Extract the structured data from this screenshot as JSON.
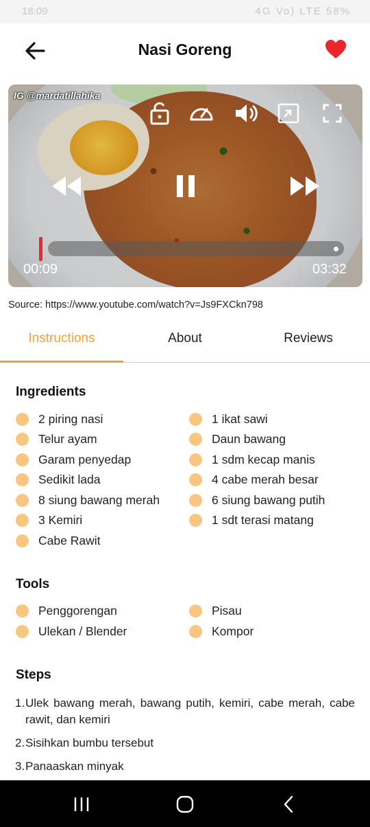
{
  "status_bar": {
    "time": "18:09",
    "right_text": "4G  Vo) LTE  58%"
  },
  "header": {
    "title": "Nasi Goreng"
  },
  "video": {
    "watermark": "IG @mardatillahika",
    "current_time": "00:09",
    "total_time": "03:32",
    "progress_fraction": 0.04
  },
  "source": "Source: https://www.youtube.com/watch?v=Js9FXCkn798",
  "tabs": [
    "Instructions",
    "About",
    "Reviews"
  ],
  "active_tab": "Instructions",
  "ingredients": {
    "title": "Ingredients",
    "left": [
      "2 piring nasi",
      "Telur ayam",
      "Garam penyedap",
      "Sedikit lada",
      "8 siung bawang merah",
      "3 Kemiri",
      "Cabe Rawit"
    ],
    "right": [
      "1 ikat sawi",
      "Daun bawang",
      "1 sdm kecap manis",
      "4 cabe merah besar",
      "6 siung bawang putih",
      "1 sdt terasi matang"
    ]
  },
  "tools": {
    "title": "Tools",
    "left": [
      "Penggorengan",
      "Ulekan / Blender"
    ],
    "right": [
      "Pisau",
      "Kompor"
    ]
  },
  "steps": {
    "title": "Steps",
    "items": [
      {
        "num": "1.",
        "text": "Ulek bawang merah, bawang putih, kemiri, cabe merah, cabe rawit, dan kemiri"
      },
      {
        "num": "2.",
        "text": "Sisihkan bumbu tersebut"
      },
      {
        "num": "3.",
        "text": "Panaaskan minyak"
      }
    ]
  },
  "colors": {
    "accent": "#f0a234",
    "bullet": "#f9c682",
    "heart": "#e8262b",
    "progress": "#e8282b"
  }
}
